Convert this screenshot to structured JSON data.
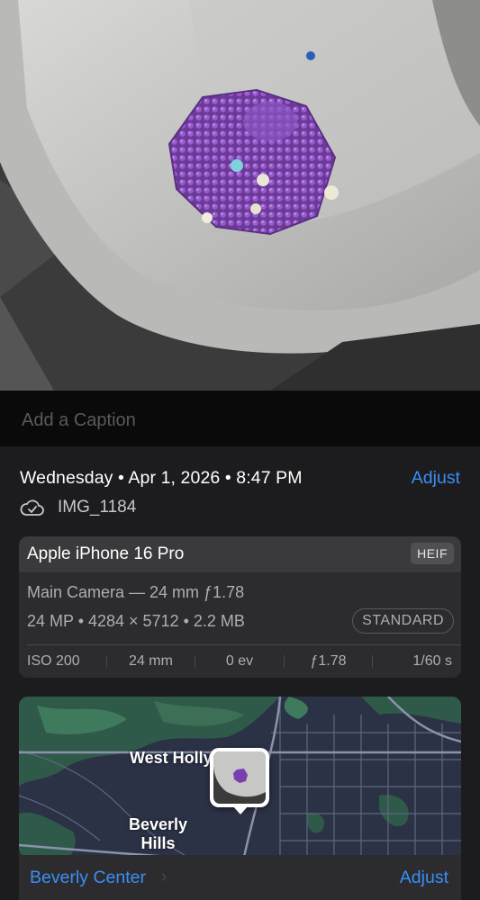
{
  "caption": {
    "placeholder": "Add a Caption"
  },
  "date_time": "Wednesday • Apr 1, 2026 • 8:47 PM",
  "top_adjust_label": "Adjust",
  "file": {
    "icon": "cloud-check-icon",
    "name": "IMG_1184"
  },
  "camera": {
    "device": "Apple iPhone 16 Pro",
    "format": "HEIF",
    "lens": "Main Camera — 24 mm ƒ1.78",
    "specs": "24 MP • 4284 × 5712 • 2.2 MB",
    "style": "STANDARD",
    "exif": [
      "ISO 200",
      "24 mm",
      "0 ev",
      "ƒ1.78",
      "1/60 s"
    ]
  },
  "map": {
    "labels": {
      "west_hollywood": "West Holly",
      "beverly_hills": "Beverly\nHills"
    },
    "place": "Beverly Center",
    "chevron": "›",
    "adjust_label": "Adjust"
  },
  "colors": {
    "accent": "#3a8ef6",
    "background": "#1c1c1e",
    "card": "#2c2c2e"
  }
}
